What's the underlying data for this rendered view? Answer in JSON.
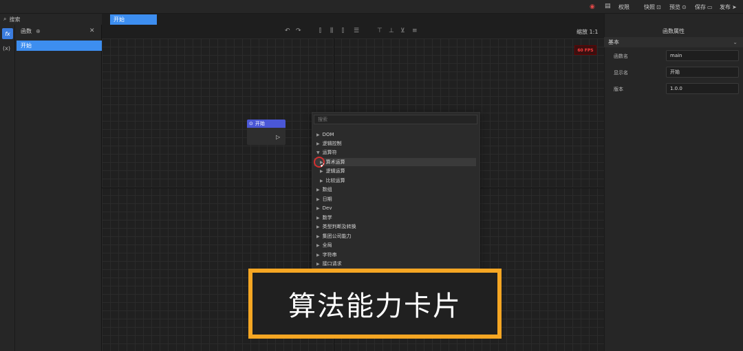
{
  "topbar": {
    "items": [
      {
        "label": "权限",
        "icon": "lock-icon"
      },
      {
        "label": "快照",
        "icon": "camera-icon"
      },
      {
        "label": "预览",
        "icon": "eye-icon"
      },
      {
        "label": "保存",
        "icon": "save-icon"
      },
      {
        "label": "发布",
        "icon": "send-icon"
      }
    ]
  },
  "left": {
    "search_placeholder": "搜索",
    "header_label": "函数",
    "fx_label": "fx",
    "var_label": "(x)",
    "items": [
      {
        "label": "开始"
      }
    ]
  },
  "tabs": [
    {
      "label": "开始"
    }
  ],
  "canvas": {
    "zoom_label": "缩放 1:1",
    "fps": "60 FPS",
    "node": {
      "title": "开始"
    }
  },
  "menu": {
    "search_placeholder": "搜索",
    "items": [
      {
        "label": "DOM",
        "expanded": false
      },
      {
        "label": "逻辑控制",
        "expanded": false
      },
      {
        "label": "运算符",
        "expanded": true
      },
      {
        "label": "算术运算",
        "sub": true,
        "highlighted": true
      },
      {
        "label": "逻辑运算",
        "sub": true
      },
      {
        "label": "比较运算",
        "sub": true
      },
      {
        "label": "数组",
        "expanded": false
      },
      {
        "label": "日期",
        "expanded": false
      },
      {
        "label": "Dev",
        "expanded": false
      },
      {
        "label": "数学",
        "expanded": false
      },
      {
        "label": "类型判断及转换",
        "expanded": false
      },
      {
        "label": "集团公司能力",
        "expanded": false
      },
      {
        "label": "全局",
        "expanded": false
      },
      {
        "label": "字符串",
        "expanded": false
      },
      {
        "label": "接口请求",
        "expanded": false
      }
    ]
  },
  "right": {
    "title": "函数属性",
    "section": "基本",
    "props": [
      {
        "label": "函数名",
        "value": "main"
      },
      {
        "label": "显示名",
        "value": "开始"
      },
      {
        "label": "版本",
        "value": "1.0.0"
      }
    ]
  },
  "caption": {
    "text": "算法能力卡片"
  },
  "colors": {
    "accent": "#3d8ef0",
    "node_header": "#4a57d6",
    "caption_border": "#f5a623",
    "fps_red": "#ff3d3d"
  }
}
